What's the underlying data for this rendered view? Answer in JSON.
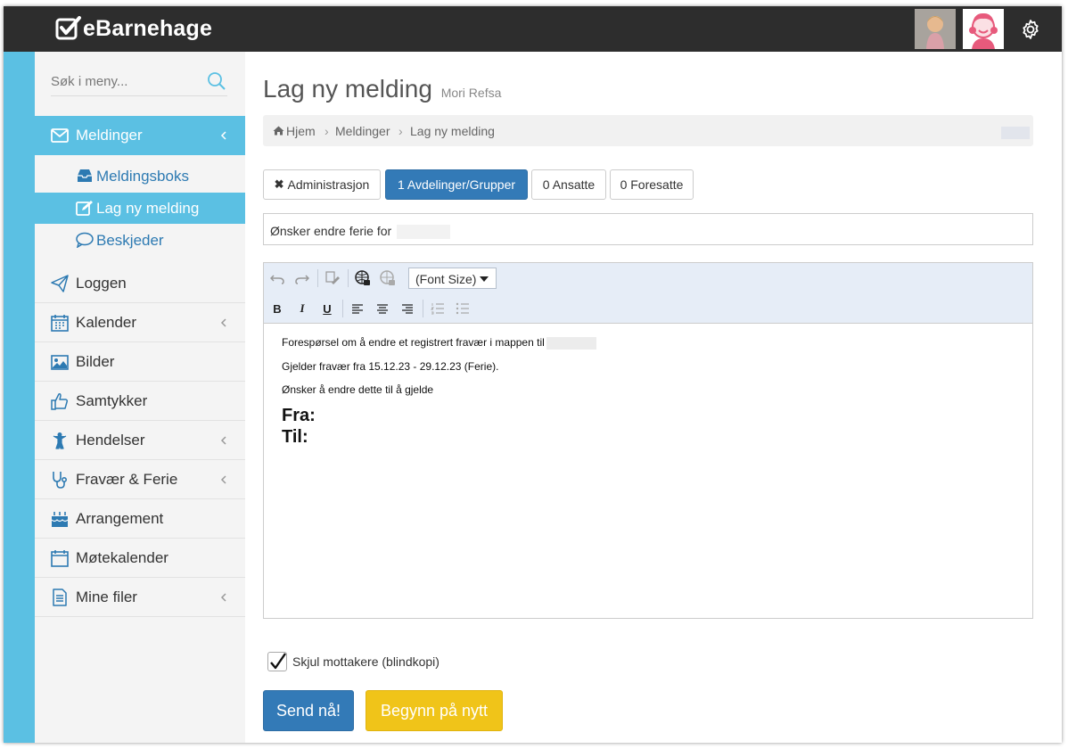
{
  "app": {
    "name": "eBarnehage"
  },
  "sidebar": {
    "search_placeholder": "Søk i meny...",
    "items": [
      {
        "label": "Meldinger",
        "icon": "envelope-icon"
      },
      {
        "label": "Loggen",
        "icon": "paper-plane-icon"
      },
      {
        "label": "Kalender",
        "icon": "calendar-icon"
      },
      {
        "label": "Bilder",
        "icon": "image-icon"
      },
      {
        "label": "Samtykker",
        "icon": "thumbs-up-icon"
      },
      {
        "label": "Hendelser",
        "icon": "child-icon"
      },
      {
        "label": "Fravær & Ferie",
        "icon": "stethoscope-icon"
      },
      {
        "label": "Arrangement",
        "icon": "cake-icon"
      },
      {
        "label": "Møtekalender",
        "icon": "calendar-empty-icon"
      },
      {
        "label": "Mine filer",
        "icon": "file-icon"
      }
    ],
    "subitems": [
      {
        "label": "Meldingsboks",
        "icon": "inbox-icon"
      },
      {
        "label": "Lag ny melding",
        "icon": "edit-icon"
      },
      {
        "label": "Beskjeder",
        "icon": "comment-icon"
      }
    ]
  },
  "page": {
    "title": "Lag ny melding",
    "subtitle": "Mori Refsa"
  },
  "breadcrumb": [
    "Hjem",
    "Meldinger",
    "Lag ny melding"
  ],
  "recipients": {
    "admin": "Administrasjon",
    "groups": "1 Avdelinger/Grupper",
    "staff": "0 Ansatte",
    "guardians": "0 Foresatte"
  },
  "subject": {
    "value": "Ønsker endre ferie for"
  },
  "editor": {
    "font_size_label": "(Font Size)",
    "bold": "B",
    "italic": "I",
    "underline": "U",
    "line1": "Forespørsel om å endre et registrert fravær i mappen til",
    "line2": "Gjelder fravær fra 15.12.23 - 29.12.23 (Ferie).",
    "line3": "Ønsker å endre dette til å gjelde",
    "from": "Fra:",
    "to": "Til:"
  },
  "options": {
    "hide_recipients": "Skjul mottakere (blindkopi)",
    "hide_recipients_checked": true
  },
  "actions": {
    "send": "Send nå!",
    "reset": "Begynn på nytt"
  },
  "colors": {
    "accent": "#5bc0e3",
    "primary": "#337ab7",
    "warning": "#f0c419",
    "topbar": "#2d2d2d"
  }
}
